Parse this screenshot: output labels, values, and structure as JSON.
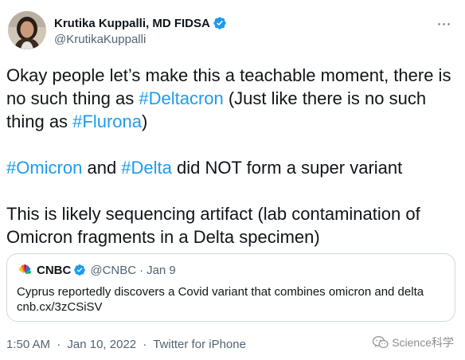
{
  "author": {
    "display_name": "Krutika Kuppalli, MD FIDSA",
    "handle": "@KrutikaKuppalli",
    "verified_icon": "verified-badge-icon"
  },
  "tweet": {
    "p1": {
      "t1": "Okay people let’s make this a teachable moment, there is no such thing as ",
      "h1": "#Deltacron",
      "t2": " (Just like there is no such thing as ",
      "h2": "#Flurona",
      "t3": ")"
    },
    "p2": {
      "h1": "#Omicron",
      "t1": " and ",
      "h2": "#Delta",
      "t2": " did NOT form a super variant"
    },
    "p3": {
      "t1": "This is likely sequencing artifact (lab contamination of Omicron fragments in a Delta specimen)"
    }
  },
  "quoted": {
    "name": "CNBC",
    "handle": "@CNBC",
    "separator": "·",
    "time": "Jan 9",
    "text_line1": "Cyprus reportedly discovers a Covid variant that combines omicron and delta",
    "text_line2": "cnb.cx/3zCSiSV"
  },
  "meta": {
    "time": "1:50 AM",
    "separator1": "·",
    "date": "Jan 10, 2022",
    "separator2": "·",
    "source": "Twitter for iPhone"
  },
  "watermark": {
    "text": "Science科学"
  },
  "colors": {
    "link": "#1d9bf0",
    "text": "#0f1419",
    "secondary": "#536471",
    "border": "#cfd9de"
  }
}
